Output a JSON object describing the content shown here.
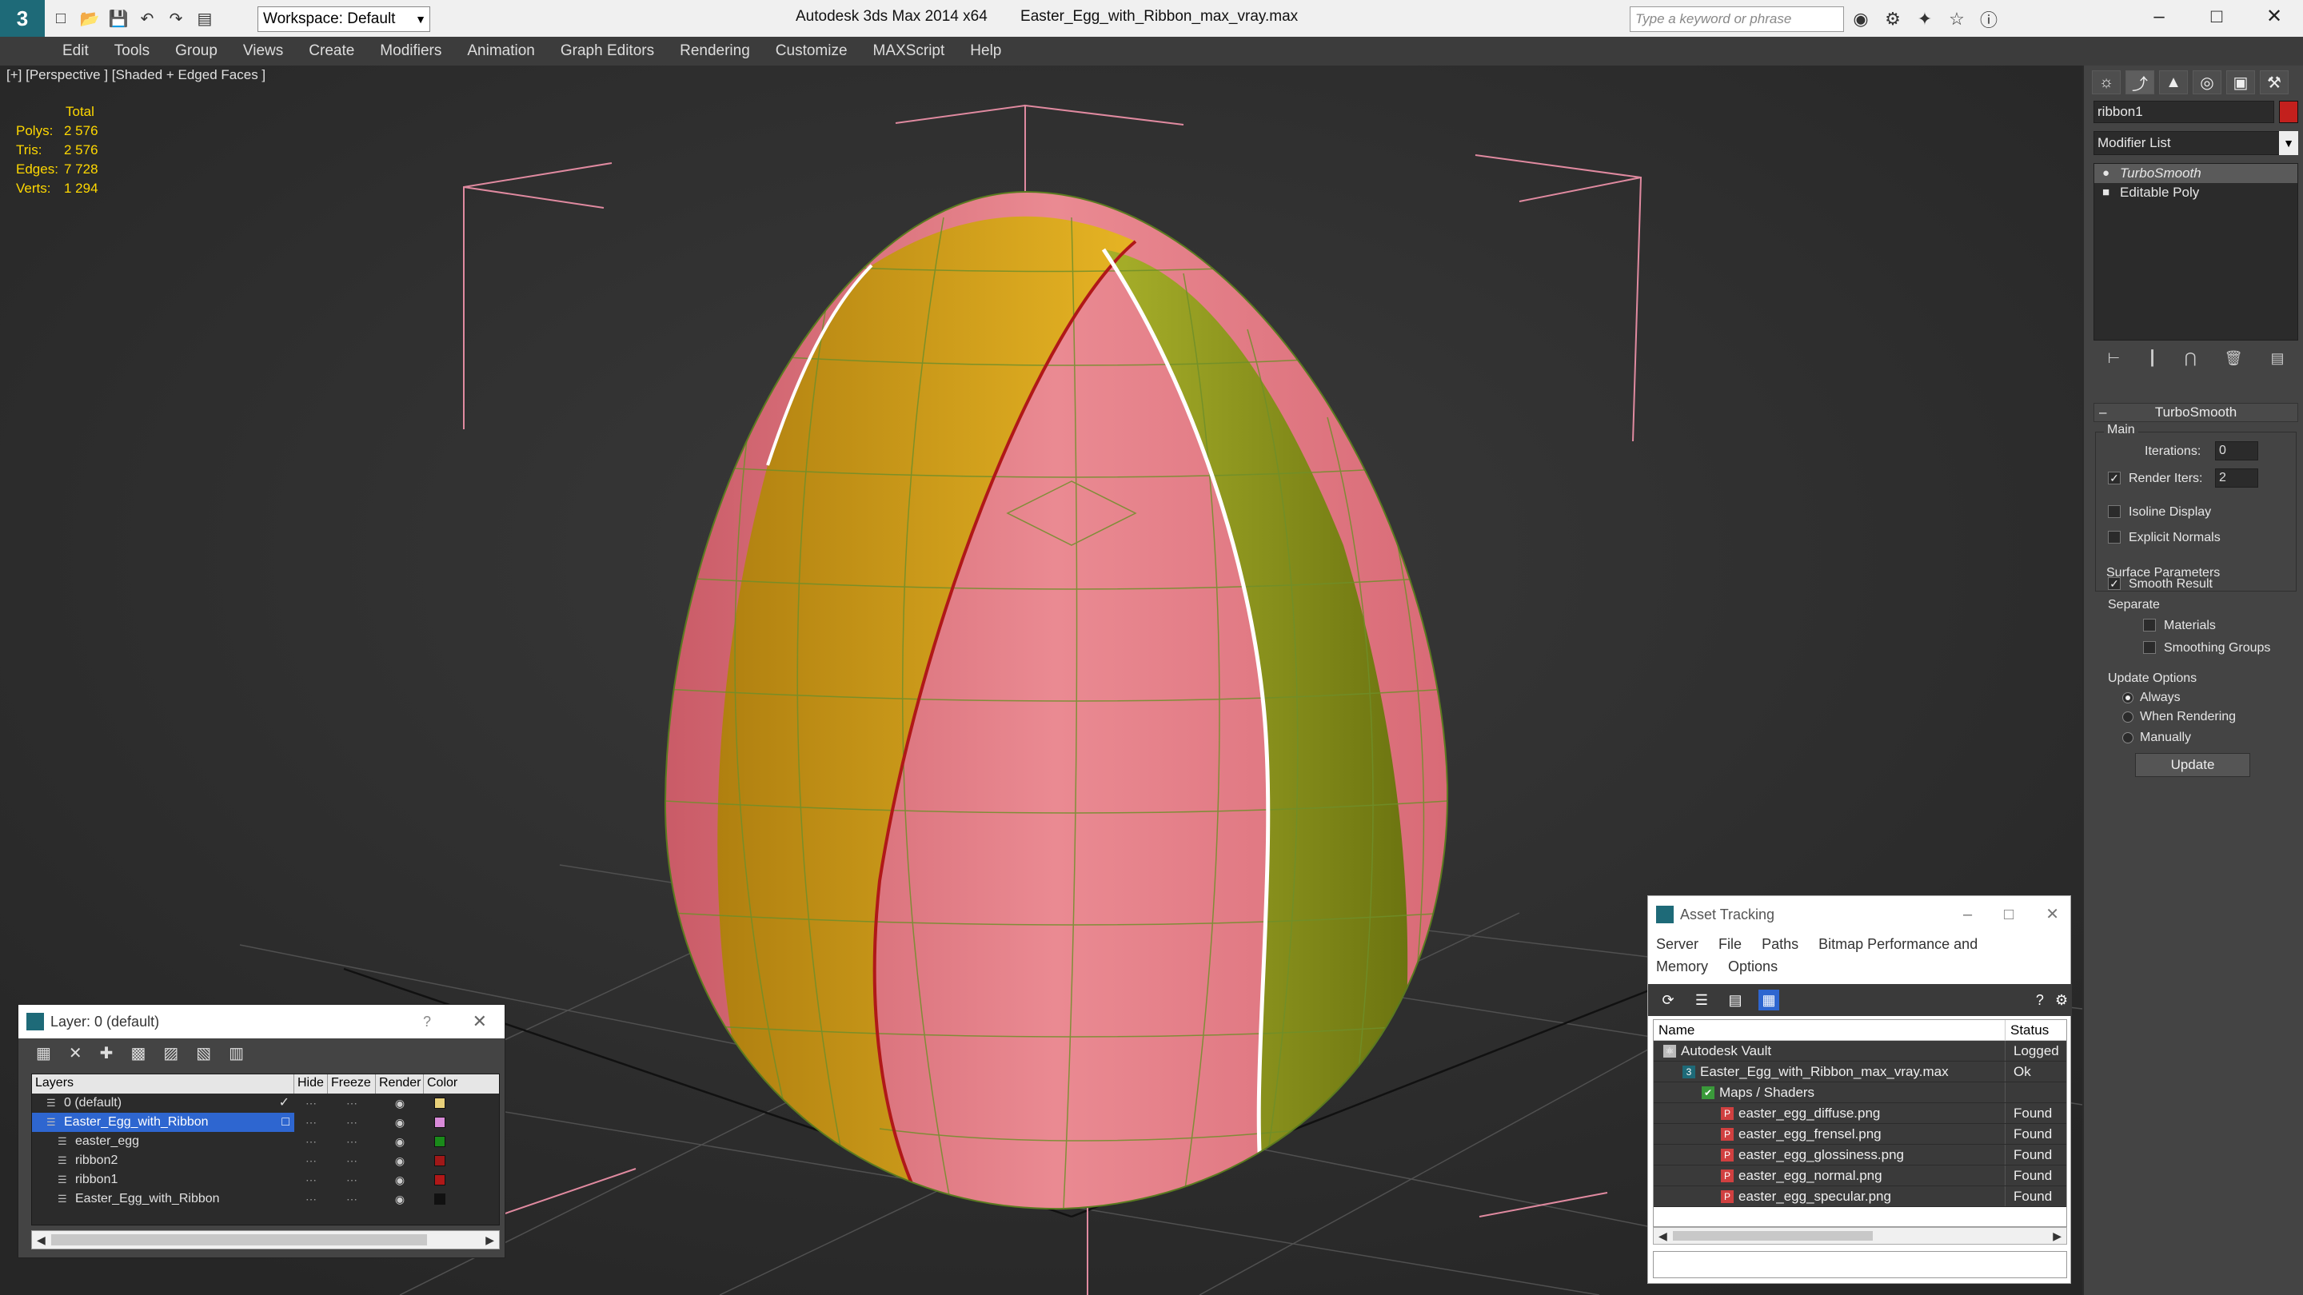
{
  "titlebar": {
    "workspace": "Workspace: Default",
    "app_name": "Autodesk 3ds Max  2014 x64",
    "file_name": "Easter_Egg_with_Ribbon_max_vray.max",
    "search_placeholder": "Type a keyword or phrase"
  },
  "menu": [
    "Edit",
    "Tools",
    "Group",
    "Views",
    "Create",
    "Modifiers",
    "Animation",
    "Graph Editors",
    "Rendering",
    "Customize",
    "MAXScript",
    "Help"
  ],
  "viewport": {
    "label": "[+] [Perspective ] [Shaded + Edged Faces ]",
    "stats": {
      "total_label": "Total",
      "rows": [
        {
          "k": "Polys:",
          "v": "2 576"
        },
        {
          "k": "Tris:",
          "v": "2 576"
        },
        {
          "k": "Edges:",
          "v": "7 728"
        },
        {
          "k": "Verts:",
          "v": "1 294"
        }
      ]
    }
  },
  "command_panel": {
    "object_name": "ribbon1",
    "object_color": "#c3201d",
    "modifier_list": "Modifier List",
    "stack": [
      "TurboSmooth",
      "Editable Poly"
    ],
    "rollout": "TurboSmooth",
    "main_group": "Main",
    "iterations_label": "Iterations:",
    "iterations": "0",
    "render_iters_label": "Render Iters:",
    "render_iters": "2",
    "isoline": "Isoline Display",
    "explicit_normals": "Explicit Normals",
    "surface_group": "Surface Parameters",
    "smooth_result": "Smooth Result",
    "separate": "Separate",
    "materials": "Materials",
    "smoothing_groups": "Smoothing Groups",
    "update_group": "Update Options",
    "always": "Always",
    "when_rendering": "When Rendering",
    "manually": "Manually",
    "update_btn": "Update"
  },
  "layer_dialog": {
    "title": "Layer: 0 (default)",
    "help": "?",
    "columns": [
      "Layers",
      "Hide",
      "Freeze",
      "Render",
      "Color"
    ],
    "rows": [
      {
        "name": "0 (default)",
        "indent": 1,
        "color": "#e8d07a",
        "check": "✓"
      },
      {
        "name": "Easter_Egg_with_Ribbon",
        "indent": 1,
        "color": "#d88ad8",
        "selected": true,
        "check": "□"
      },
      {
        "name": "easter_egg",
        "indent": 2,
        "color": "#1a8a1a",
        "check": ""
      },
      {
        "name": "ribbon2",
        "indent": 2,
        "color": "#a01818",
        "check": ""
      },
      {
        "name": "ribbon1",
        "indent": 2,
        "color": "#b01818",
        "check": ""
      },
      {
        "name": "Easter_Egg_with_Ribbon",
        "indent": 2,
        "color": "#111111",
        "check": ""
      }
    ]
  },
  "asset_tracking": {
    "title": "Asset Tracking",
    "menu": [
      "Server",
      "File",
      "Paths",
      "Bitmap Performance and Memory",
      "Options"
    ],
    "columns": [
      "Name",
      "Status"
    ],
    "rows": [
      {
        "name": "Autodesk Vault",
        "status": "Logged",
        "indent": 0,
        "icon": "vault"
      },
      {
        "name": "Easter_Egg_with_Ribbon_max_vray.max",
        "status": "Ok",
        "indent": 1,
        "icon": "max"
      },
      {
        "name": "Maps / Shaders",
        "status": "",
        "indent": 2,
        "icon": "folder"
      },
      {
        "name": "easter_egg_diffuse.png",
        "status": "Found",
        "indent": 3,
        "icon": "png"
      },
      {
        "name": "easter_egg_frensel.png",
        "status": "Found",
        "indent": 3,
        "icon": "png"
      },
      {
        "name": "easter_egg_glossiness.png",
        "status": "Found",
        "indent": 3,
        "icon": "png"
      },
      {
        "name": "easter_egg_normal.png",
        "status": "Found",
        "indent": 3,
        "icon": "png"
      },
      {
        "name": "easter_egg_specular.png",
        "status": "Found",
        "indent": 3,
        "icon": "png"
      }
    ]
  },
  "colors": {
    "egg_pink": "#e67a84",
    "ribbon_yellow": "#d8a818",
    "ribbon_green": "#9aa41e",
    "wire": "#7a9a3a",
    "select": "#2e66d0"
  }
}
